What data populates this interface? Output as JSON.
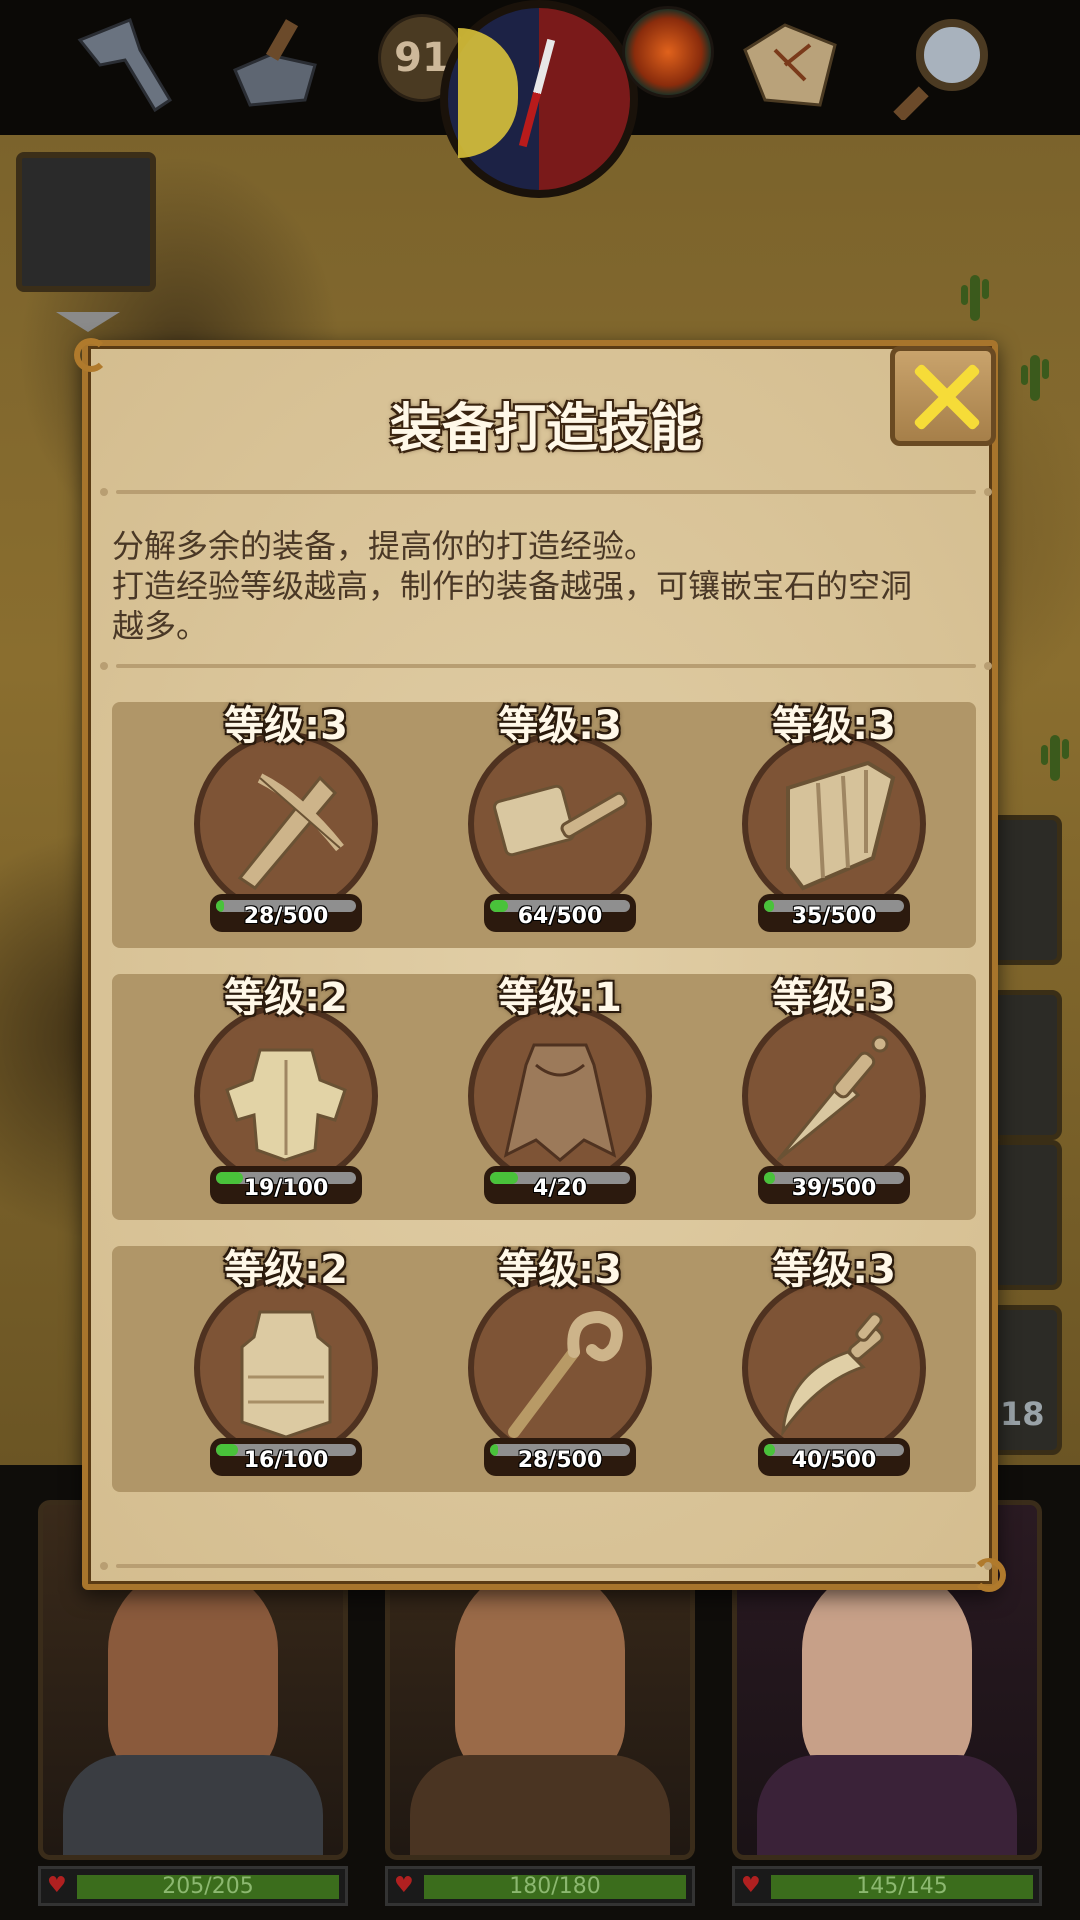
{
  "dialog": {
    "title": "装备打造技能",
    "description": [
      "分解多余的装备，提高你的打造经验。",
      "打造经验等级越高，制作的装备越强，可镶嵌宝石的空洞",
      "越多。"
    ]
  },
  "hud": {
    "level": "91",
    "side_count": "18"
  },
  "skills": [
    {
      "level": "等级:3",
      "progress": "28/500",
      "fraction": 0.056,
      "icon": "crossbow-icon"
    },
    {
      "level": "等级:3",
      "progress": "64/500",
      "fraction": 0.128,
      "icon": "hammer-icon"
    },
    {
      "level": "等级:3",
      "progress": "35/500",
      "fraction": 0.07,
      "icon": "shield-icon"
    },
    {
      "level": "等级:2",
      "progress": "19/100",
      "fraction": 0.19,
      "icon": "plate-armor-icon"
    },
    {
      "level": "等级:1",
      "progress": "4/20",
      "fraction": 0.2,
      "icon": "cloak-icon"
    },
    {
      "level": "等级:3",
      "progress": "39/500",
      "fraction": 0.078,
      "icon": "dagger-icon"
    },
    {
      "level": "等级:2",
      "progress": "16/100",
      "fraction": 0.16,
      "icon": "breastplate-icon"
    },
    {
      "level": "等级:3",
      "progress": "28/500",
      "fraction": 0.056,
      "icon": "staff-icon"
    },
    {
      "level": "等级:3",
      "progress": "40/500",
      "fraction": 0.08,
      "icon": "curved-blade-icon"
    }
  ],
  "heroes": [
    {
      "hp": "205/205"
    },
    {
      "hp": "180/180"
    },
    {
      "hp": "145/145"
    }
  ],
  "colors": {
    "panel": "#d9c49a",
    "panel_border": "#a8752c",
    "row_bg": "#b09668",
    "progress_green": "#49c23a",
    "close_x": "#f6dc38"
  }
}
